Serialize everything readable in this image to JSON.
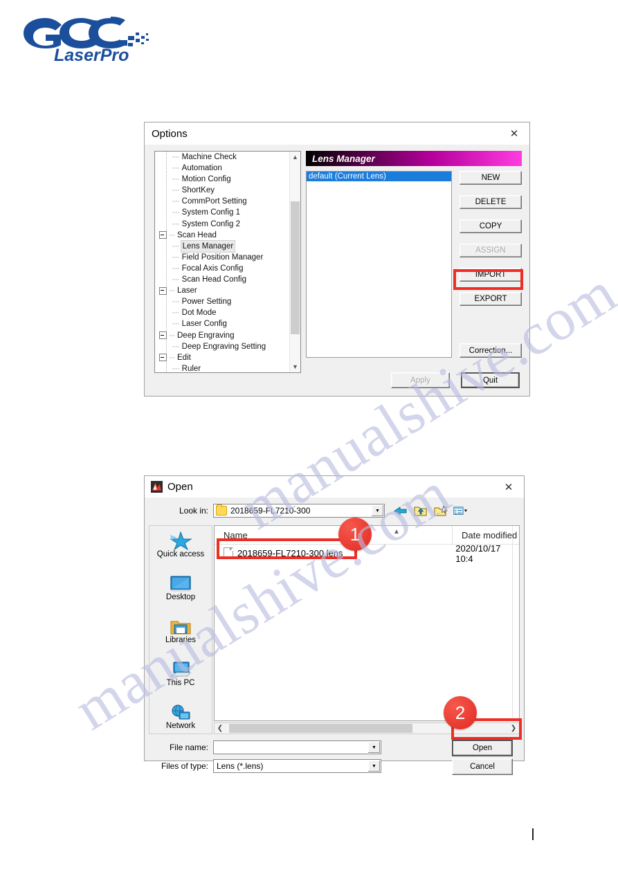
{
  "logo": {
    "brand": "GCC",
    "sub": "LaserPro"
  },
  "watermark": {
    "text": "manualshive.com"
  },
  "options_dialog": {
    "title": "Options",
    "close_icon": "close-icon",
    "tree": [
      {
        "label": "Machine Check",
        "level": 1,
        "expander": false,
        "selected": false
      },
      {
        "label": "Automation",
        "level": 1,
        "expander": false,
        "selected": false
      },
      {
        "label": "Motion Config",
        "level": 1,
        "expander": false,
        "selected": false
      },
      {
        "label": "ShortKey",
        "level": 1,
        "expander": false,
        "selected": false
      },
      {
        "label": "CommPort Setting",
        "level": 1,
        "expander": false,
        "selected": false
      },
      {
        "label": "System Config 1",
        "level": 1,
        "expander": false,
        "selected": false
      },
      {
        "label": "System Config 2",
        "level": 1,
        "expander": false,
        "selected": false
      },
      {
        "label": "Scan Head",
        "level": 0,
        "expander": true,
        "selected": false
      },
      {
        "label": "Lens Manager",
        "level": 1,
        "expander": false,
        "selected": true
      },
      {
        "label": "Field Position Manager",
        "level": 1,
        "expander": false,
        "selected": false
      },
      {
        "label": "Focal Axis Config",
        "level": 1,
        "expander": false,
        "selected": false
      },
      {
        "label": "Scan Head Config",
        "level": 1,
        "expander": false,
        "selected": false
      },
      {
        "label": "Laser",
        "level": 0,
        "expander": true,
        "selected": false
      },
      {
        "label": "Power Setting",
        "level": 1,
        "expander": false,
        "selected": false
      },
      {
        "label": "Dot Mode",
        "level": 1,
        "expander": false,
        "selected": false
      },
      {
        "label": "Laser Config",
        "level": 1,
        "expander": false,
        "selected": false
      },
      {
        "label": "Deep Engraving",
        "level": 0,
        "expander": true,
        "selected": false
      },
      {
        "label": "Deep Engraving Setting",
        "level": 1,
        "expander": false,
        "selected": false
      },
      {
        "label": "Edit",
        "level": 0,
        "expander": true,
        "selected": false
      },
      {
        "label": "Ruler",
        "level": 1,
        "expander": false,
        "selected": false
      }
    ],
    "panel": {
      "header": "Lens Manager",
      "header_gradient_from": "#000000",
      "header_gradient_to": "#ff3ce0",
      "list_items": [
        "default (Current Lens)"
      ],
      "list_selection_color": "#1a7ddc",
      "buttons": [
        {
          "label": "NEW",
          "disabled": false,
          "highlighted": false
        },
        {
          "label": "DELETE",
          "disabled": false,
          "highlighted": false
        },
        {
          "label": "COPY",
          "disabled": false,
          "highlighted": false
        },
        {
          "label": "ASSIGN",
          "disabled": true,
          "highlighted": false
        },
        {
          "label": "IMPORT",
          "disabled": false,
          "highlighted": true
        },
        {
          "label": "EXPORT",
          "disabled": false,
          "highlighted": false
        }
      ],
      "correction_button": "Correction..."
    },
    "apply_button": "Apply",
    "apply_disabled": true,
    "quit_button": "Quit",
    "highlight_color": "#ee2d24"
  },
  "open_dialog": {
    "title": "Open",
    "app_icon": "app-icon",
    "close_icon": "close-icon",
    "look_in_label": "Look in:",
    "look_in_value": "2018659-FL7210-300",
    "toolbar": [
      {
        "name": "back-icon"
      },
      {
        "name": "up-folder-icon"
      },
      {
        "name": "new-folder-icon"
      },
      {
        "name": "views-icon"
      }
    ],
    "places": [
      {
        "label": "Quick access",
        "icon": "star-icon"
      },
      {
        "label": "Desktop",
        "icon": "desktop-icon"
      },
      {
        "label": "Libraries",
        "icon": "libraries-icon"
      },
      {
        "label": "This PC",
        "icon": "this-pc-icon"
      },
      {
        "label": "Network",
        "icon": "network-icon"
      }
    ],
    "columns": [
      "Name",
      "Date modified"
    ],
    "rows": [
      {
        "name": "2018659-FL7210-300.lens",
        "date": "2020/10/17 10:4"
      }
    ],
    "file_name_label": "File name:",
    "file_name_value": "",
    "files_of_type_label": "Files of type:",
    "files_of_type_value": "Lens (*.lens)",
    "open_button": "Open",
    "cancel_button": "Cancel"
  },
  "annotations": [
    {
      "number": "1"
    },
    {
      "number": "2"
    }
  ]
}
